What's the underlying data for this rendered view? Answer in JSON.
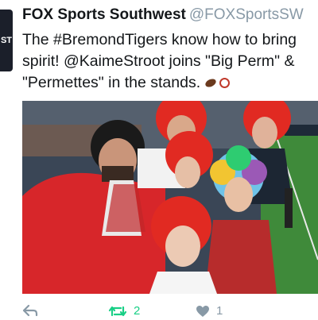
{
  "tweet": {
    "avatar_text": "ST",
    "display_name": "FOX Sports Southwest",
    "handle": "@FOXSportsSW",
    "text_lines": [
      "The #BremondTigers know how to bring",
      "spirit! @KaimeStroot joins \"Big Perm\" &",
      "\"Permettes\" in the stands."
    ],
    "emoji": [
      "football-icon",
      "ferris-wheel-icon"
    ],
    "retweet_count": "2",
    "like_count": "1",
    "colors": {
      "retweet_active": "#19cf86",
      "muted": "#8899a6"
    }
  }
}
